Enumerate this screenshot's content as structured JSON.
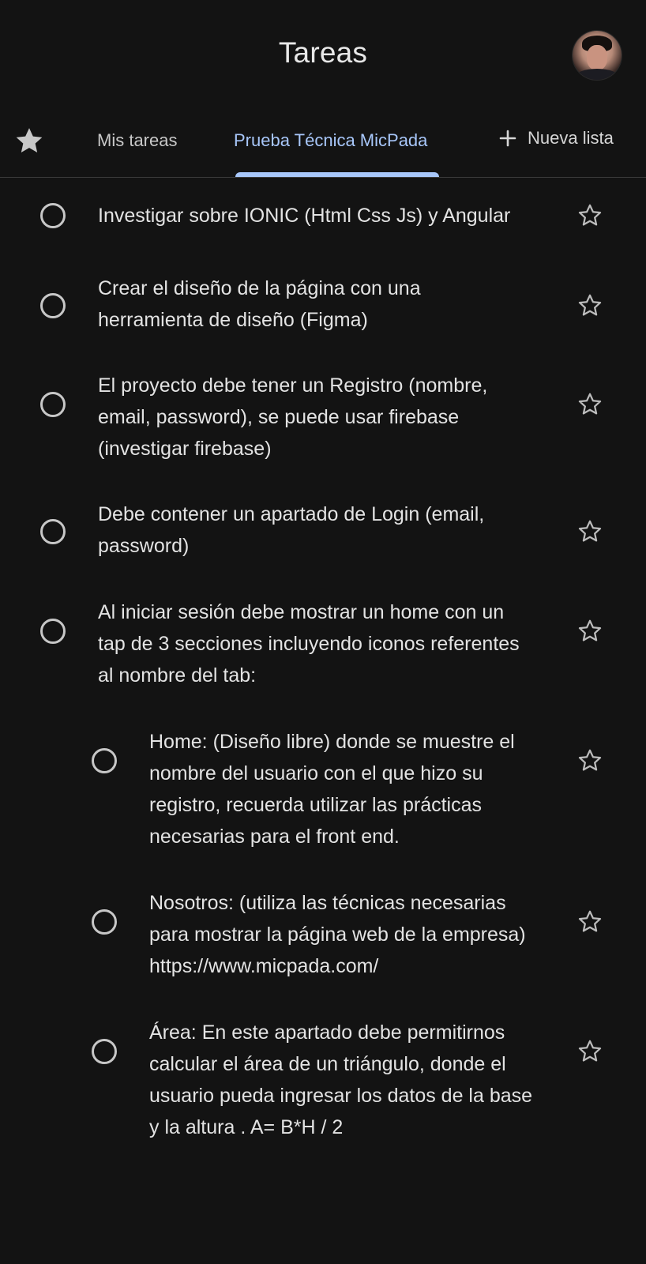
{
  "header": {
    "title": "Tareas"
  },
  "tabs": {
    "starred_icon": "star-filled-icon",
    "items": [
      {
        "label": "Mis tareas",
        "selected": false
      },
      {
        "label": "Prueba Técnica MicPada",
        "selected": true
      }
    ],
    "new_list_label": "Nueva lista",
    "accent_color": "#a8c7fa"
  },
  "tasks": [
    {
      "text": "Investigar sobre IONIC (Html Css Js) y Angular",
      "subtask": false,
      "starred": false
    },
    {
      "text": "Crear el diseño de la página con una herramienta de diseño (Figma)",
      "subtask": false,
      "starred": false
    },
    {
      "text": "El proyecto debe tener un Registro (nombre, email, password), se puede usar firebase (investigar firebase)",
      "subtask": false,
      "starred": false
    },
    {
      "text": "Debe contener un apartado de Login (email, password)",
      "subtask": false,
      "starred": false
    },
    {
      "text": "Al iniciar sesión debe mostrar un home con un tap de 3 secciones incluyendo iconos referentes al nombre del tab:",
      "subtask": false,
      "starred": false
    },
    {
      "text": "Home: (Diseño libre) donde se muestre el nombre del usuario con el que hizo su registro, recuerda utilizar las prácticas necesarias para el front end.",
      "subtask": true,
      "starred": false
    },
    {
      "text": "Nosotros: (utiliza las técnicas necesarias para mostrar la página web de la empresa) https://www.micpada.com/",
      "subtask": true,
      "starred": false
    },
    {
      "text": "Área: En este apartado debe permitirnos calcular el área de un triángulo, donde el usuario pueda ingresar los datos de la base y la altura . A= B*H / 2",
      "subtask": true,
      "starred": false
    }
  ]
}
